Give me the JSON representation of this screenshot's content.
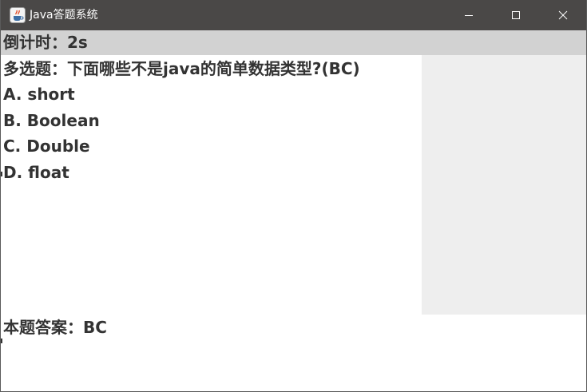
{
  "window": {
    "title": "Java答题系统",
    "icon": "java-cup-icon",
    "controls": {
      "minimize": "minimize-icon",
      "maximize": "maximize-icon",
      "close": "close-icon"
    },
    "colors": {
      "titlebar": "#4a4847",
      "countdown_bar": "#d2d2d2",
      "side_panel": "#eeeeee",
      "text": "#333333"
    }
  },
  "countdown": {
    "text": "倒计时：2s"
  },
  "question": {
    "text": "多选题：下面哪些不是java的简单数据类型?(BC)",
    "options": [
      {
        "label": "A. short"
      },
      {
        "label": "B. Boolean"
      },
      {
        "label": "C. Double"
      },
      {
        "label": "D. float"
      }
    ]
  },
  "answer": {
    "text": "本题答案：BC"
  }
}
